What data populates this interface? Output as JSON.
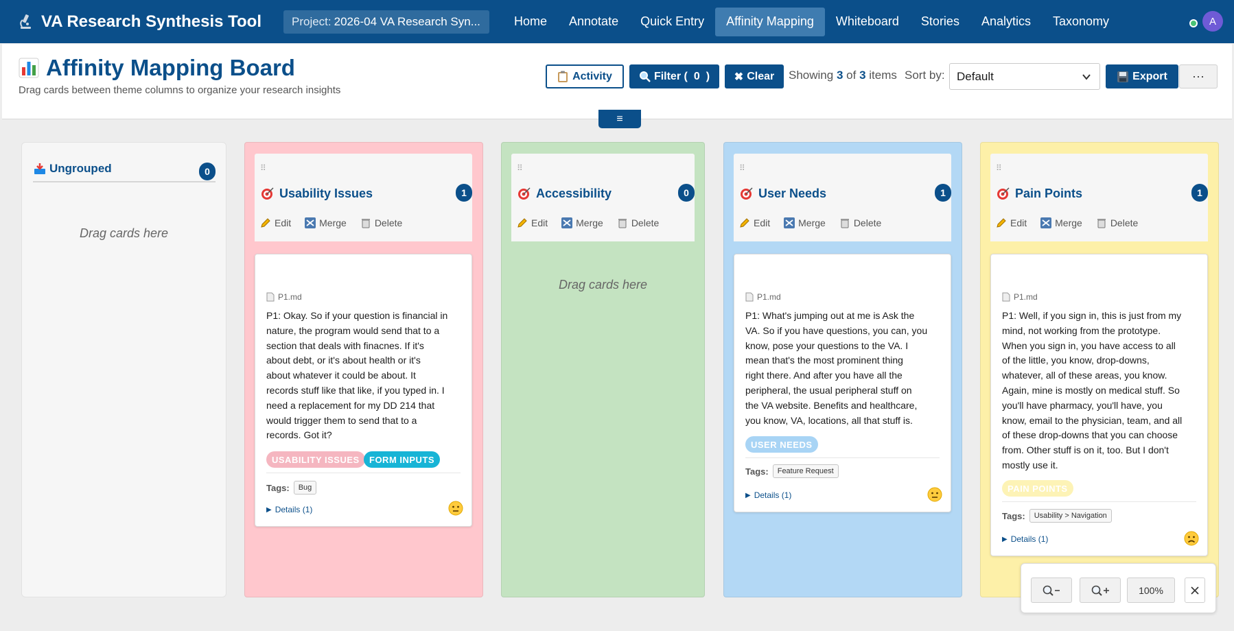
{
  "app": {
    "title": "VA Research Synthesis Tool",
    "logo_icon": "microscope-icon"
  },
  "project": {
    "label": "Project:",
    "name": "2026-04 VA Research Syn..."
  },
  "nav": {
    "items": [
      {
        "label": "Home",
        "active": false
      },
      {
        "label": "Annotate",
        "active": false
      },
      {
        "label": "Quick Entry",
        "active": false
      },
      {
        "label": "Affinity Mapping",
        "active": true
      },
      {
        "label": "Whiteboard",
        "active": false
      },
      {
        "label": "Stories",
        "active": false
      },
      {
        "label": "Analytics",
        "active": false
      },
      {
        "label": "Taxonomy",
        "active": false
      }
    ],
    "avatar_initial": "A",
    "status_color": "#4ac274"
  },
  "header": {
    "title": "Affinity Mapping Board",
    "title_icon": "bar-chart-icon",
    "subtitle": "Drag cards between theme columns to organize your research insights",
    "activity_label": "Activity",
    "filter_label": "Filter (",
    "filter_count": "0",
    "filter_close": ")",
    "clear_label": "Clear",
    "showing_prefix": "Showing",
    "showing_count": "3",
    "showing_of": "of",
    "showing_total": "3",
    "showing_suffix": "items",
    "sort_label": "Sort by:",
    "sort_value": "Default",
    "export_label": "Export",
    "more_label": "···",
    "collapse_icon": "≡"
  },
  "ungrouped": {
    "title": "Ungrouped",
    "count": "0",
    "empty_text": "Drag cards here"
  },
  "themes": [
    {
      "title": "Usability Issues",
      "count": "1",
      "bg": "#ffc7cd",
      "edit": "Edit",
      "merge": "Merge",
      "delete": "Delete",
      "card": {
        "file": "P1.md",
        "text_lines": [
          "P1: Okay. So if your question is financial in",
          "nature, the program would send that to a",
          "section that deals with finacnes. If it's",
          "about debt, or it's about health or it's",
          "about whatever it could be about. It",
          "records stuff like that like, if you typed in. I",
          "need a replacement for my DD 214 that",
          "would trigger them to send that to a",
          "records. Got it?"
        ],
        "pills": [
          {
            "label": "USABILITY ISSUES",
            "bg": "#f5b6c0",
            "fg": "#ffffff"
          },
          {
            "label": "FORM INPUTS",
            "bg": "#17b4d6",
            "fg": "#ffffff"
          }
        ],
        "tags_label": "Tags:",
        "tags": [
          "Bug"
        ],
        "details": "Details (1)",
        "sentiment": "neutral-face-icon"
      }
    },
    {
      "title": "Accessibility",
      "count": "0",
      "bg": "#c4e3c1",
      "edit": "Edit",
      "merge": "Merge",
      "delete": "Delete",
      "empty_text": "Drag cards here"
    },
    {
      "title": "User Needs",
      "count": "1",
      "bg": "#b3d8f5",
      "edit": "Edit",
      "merge": "Merge",
      "delete": "Delete",
      "card": {
        "file": "P1.md",
        "text_lines": [
          "P1: What's jumping out at me is Ask the",
          "VA. So if you have questions, you can, you",
          "know, pose your questions to the VA. I",
          "mean that's the most prominent thing",
          "right there. And after you have all the",
          "peripheral, the usual peripheral stuff on",
          "the VA website. Benefits and healthcare,",
          "you know, VA, locations, all that stuff is."
        ],
        "pills": [
          {
            "label": "USER NEEDS",
            "bg": "#a8d4f5",
            "fg": "#ffffff"
          }
        ],
        "tags_label": "Tags:",
        "tags": [
          "Feature Request"
        ],
        "details": "Details (1)",
        "sentiment": "neutral-face-icon"
      }
    },
    {
      "title": "Pain Points",
      "count": "1",
      "bg": "#fdf0a8",
      "edit": "Edit",
      "merge": "Merge",
      "delete": "Delete",
      "card": {
        "file": "P1.md",
        "text_lines": [
          "P1: Well, if you sign in, this is just from my",
          "mind, not working from the prototype.",
          "When you sign in, you have access to all",
          "of the little, you know, drop-downs,",
          "whatever, all of these areas, you know.",
          "Again, mine is mostly on medical stuff. So",
          "you'll have pharmacy, you'll have, you",
          "know, email to the physician, team, and all",
          "of these drop-downs that you can choose",
          "from. Other stuff is on it, too. But I don't",
          "mostly use it."
        ],
        "pills": [
          {
            "label": "PAIN POINTS",
            "bg": "#fdf3b6",
            "fg": "#ffffff"
          }
        ],
        "tags_label": "Tags:",
        "tags": [
          "Usability > Navigation"
        ],
        "details": "Details (1)",
        "sentiment": "frowning-face-icon"
      }
    }
  ],
  "zoom": {
    "zoom_out_icon": "zoom-out-icon",
    "zoom_in_icon": "zoom-in-icon",
    "level": "100%",
    "close_icon": "close-icon"
  }
}
